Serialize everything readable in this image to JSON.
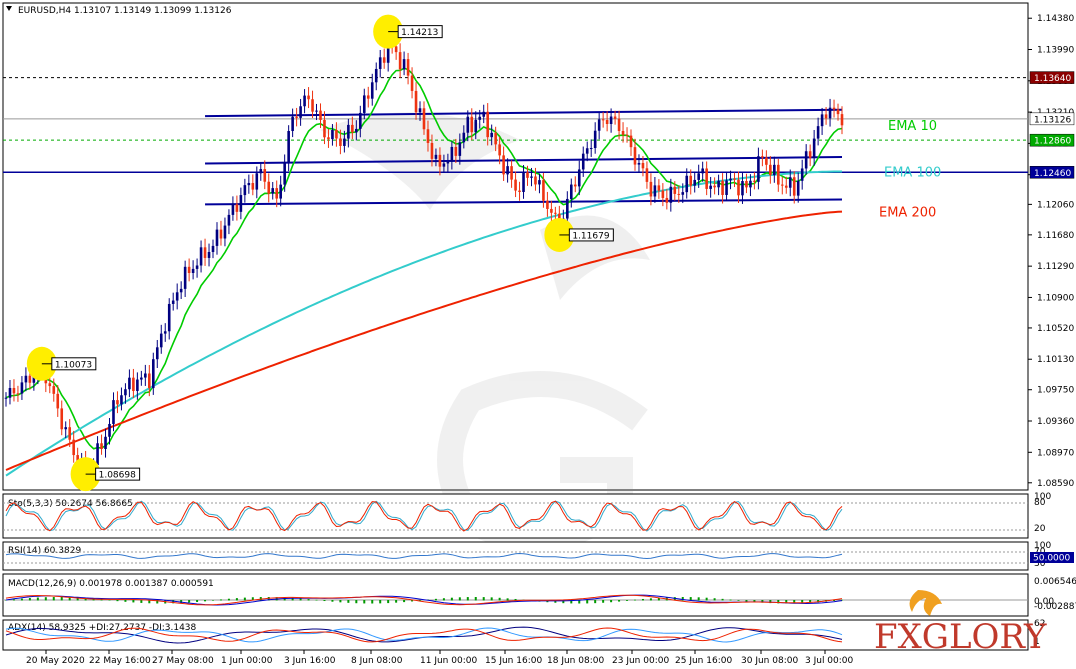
{
  "header": {
    "symbol_info": "EURUSD,H4  1.13107 1.13149 1.13099 1.13126"
  },
  "colors": {
    "ema10": "#00cc00",
    "ema100": "#33cccc",
    "ema200": "#ee2200",
    "trend": "#000099",
    "up": "#000080",
    "down": "#ee3311",
    "highlight": "#ffee00"
  },
  "chart_data": {
    "type": "candlestick",
    "y_ticks": [
      "1.14380",
      "1.13990",
      "1.13600",
      "1.13210",
      "1.12820",
      "1.12430",
      "1.12060",
      "1.11680",
      "1.11290",
      "1.10900",
      "1.10520",
      "1.10130",
      "1.09750",
      "1.09360",
      "1.08970",
      "1.08590"
    ],
    "y_range": [
      1.0855,
      1.1447
    ],
    "x_ticks": [
      "20 May 2020",
      "22 May 16:00",
      "27 May 08:00",
      "1 Jun 00:00",
      "3 Jun 16:00",
      "8 Jun 08:00",
      "11 Jun 00:00",
      "15 Jun 16:00",
      "18 Jun 08:00",
      "23 Jun 00:00",
      "25 Jun 16:00",
      "30 Jun 08:00",
      "3 Jul 00:00"
    ],
    "price_tags": [
      {
        "label": "1.13640",
        "value": 1.1364,
        "bg": "#8b0000",
        "fg": "#ffffff"
      },
      {
        "label": "1.13126",
        "value": 1.13126,
        "bg": "#ffffff",
        "fg": "#000000"
      },
      {
        "label": "1.12860",
        "value": 1.1286,
        "bg": "#00aa00",
        "fg": "#ffffff"
      },
      {
        "label": "1.12460",
        "value": 1.1246,
        "bg": "#000099",
        "fg": "#ffffff"
      }
    ],
    "levels": [
      1.1364,
      1.1286,
      1.1246
    ],
    "annotations": [
      {
        "label": "1.14213",
        "value": 1.14213,
        "index": 96
      },
      {
        "label": "1.11679",
        "value": 1.11679,
        "index": 139
      },
      {
        "label": "1.10073",
        "value": 1.10073,
        "index": 9
      },
      {
        "label": "1.08698",
        "value": 1.08698,
        "index": 20
      }
    ],
    "channels": [
      {
        "i0": 50,
        "v0": 1.1316,
        "i1": 210,
        "v1": 1.1324
      },
      {
        "i0": 50,
        "v0": 1.1257,
        "i1": 210,
        "v1": 1.1265
      },
      {
        "i0": 50,
        "v0": 1.1206,
        "i1": 210,
        "v1": 1.1212
      }
    ],
    "ema_labels": [
      {
        "name": "EMA 10",
        "value": 1.1305
      },
      {
        "name": "EMA 100",
        "value": 1.1247
      },
      {
        "name": "EMA 200",
        "value": 1.1197
      }
    ],
    "anchors": [
      [
        0,
        1.0965
      ],
      [
        5,
        1.0985
      ],
      [
        9,
        1.1007
      ],
      [
        13,
        1.095
      ],
      [
        17,
        1.0895
      ],
      [
        20,
        1.087
      ],
      [
        24,
        1.0905
      ],
      [
        28,
        1.0965
      ],
      [
        32,
        1.0985
      ],
      [
        36,
        1.099
      ],
      [
        40,
        1.106
      ],
      [
        44,
        1.111
      ],
      [
        48,
        1.1135
      ],
      [
        52,
        1.1155
      ],
      [
        56,
        1.119
      ],
      [
        60,
        1.1225
      ],
      [
        64,
        1.1245
      ],
      [
        68,
        1.121
      ],
      [
        72,
        1.1315
      ],
      [
        76,
        1.134
      ],
      [
        80,
        1.1295
      ],
      [
        84,
        1.1285
      ],
      [
        88,
        1.1305
      ],
      [
        92,
        1.136
      ],
      [
        96,
        1.1405
      ],
      [
        100,
        1.138
      ],
      [
        104,
        1.1315
      ],
      [
        108,
        1.1255
      ],
      [
        112,
        1.1265
      ],
      [
        116,
        1.1305
      ],
      [
        120,
        1.1315
      ],
      [
        124,
        1.1265
      ],
      [
        128,
        1.1225
      ],
      [
        132,
        1.1245
      ],
      [
        136,
        1.1205
      ],
      [
        139,
        1.1175
      ],
      [
        142,
        1.1225
      ],
      [
        146,
        1.1275
      ],
      [
        150,
        1.1315
      ],
      [
        154,
        1.1305
      ],
      [
        158,
        1.1265
      ],
      [
        162,
        1.1225
      ],
      [
        166,
        1.1215
      ],
      [
        170,
        1.1225
      ],
      [
        174,
        1.1245
      ],
      [
        178,
        1.1225
      ],
      [
        182,
        1.1235
      ],
      [
        186,
        1.1225
      ],
      [
        190,
        1.1265
      ],
      [
        194,
        1.1235
      ],
      [
        198,
        1.1225
      ],
      [
        202,
        1.1275
      ],
      [
        206,
        1.1325
      ],
      [
        210,
        1.1315
      ]
    ],
    "indicators": {
      "stoch": {
        "label": "Sto(5,3,3) 50.2674 56.8665",
        "ticks": [
          "100",
          "80",
          "20"
        ]
      },
      "rsi": {
        "label": "RSI(14) 60.3829",
        "ticks": [
          "100",
          "70",
          "30"
        ],
        "tag": "50.0000"
      },
      "macd": {
        "label": "MACD(12,26,9) 0.001978 0.001387 0.000591",
        "ticks": [
          "0.006546",
          "0.00",
          "-0.002887"
        ]
      },
      "adx": {
        "label": "ADX(14) 58.9325 +DI:27.2737 -DI:3.1438",
        "ticks": [
          "62",
          "1"
        ]
      }
    }
  },
  "logo": {
    "text": "FXGLORY"
  }
}
